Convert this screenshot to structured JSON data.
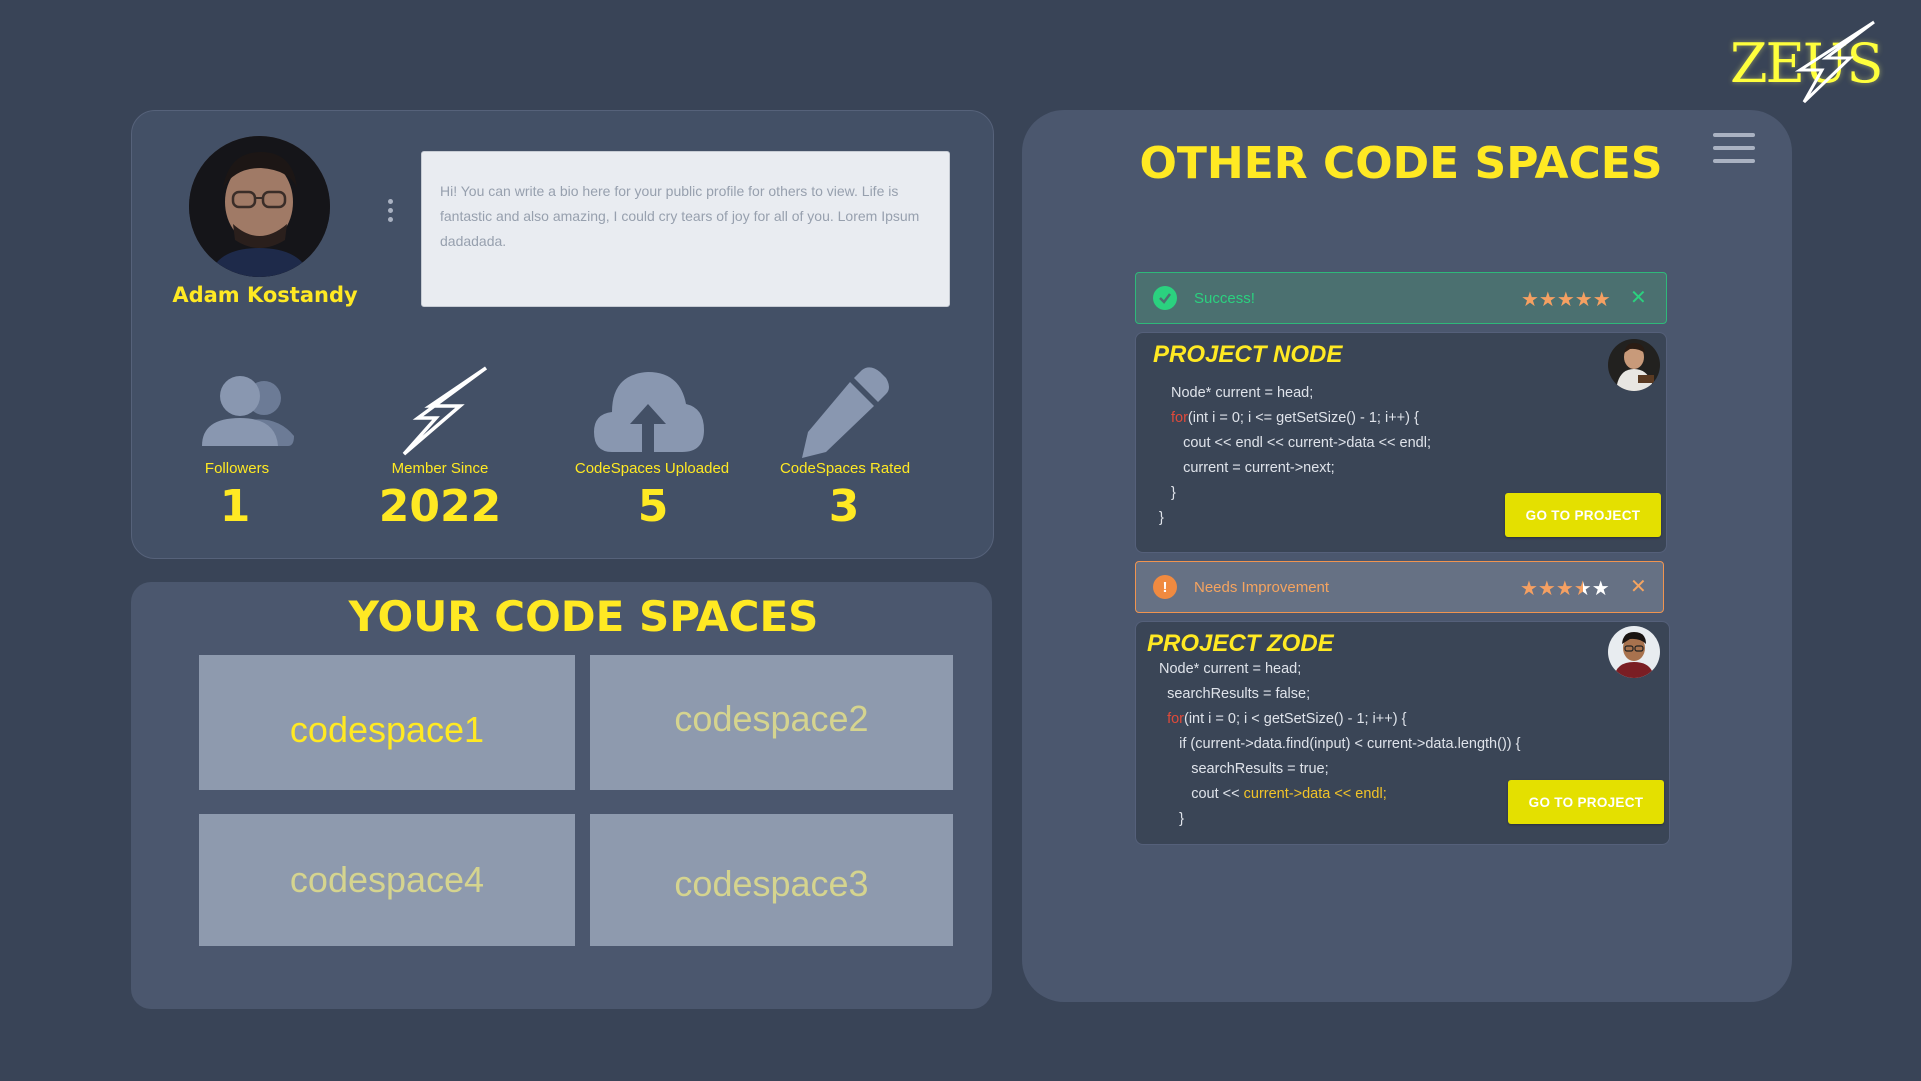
{
  "brand": {
    "logo_text": "ZEUS"
  },
  "profile": {
    "name": "Adam Kostandy",
    "bio": "Hi! You can write a bio here for your public profile for others to view. Life is fantastic and also amazing, I could cry tears of joy for all of you. Lorem Ipsum dadadada.",
    "stats": [
      {
        "label": "Followers",
        "value": "1",
        "icon": "users-icon"
      },
      {
        "label": "Member Since",
        "value": "2022",
        "icon": "lightning-icon"
      },
      {
        "label": "CodeSpaces Uploaded",
        "value": "5",
        "icon": "cloud-upload-icon"
      },
      {
        "label": "CodeSpaces Rated",
        "value": "3",
        "icon": "pencil-icon"
      }
    ]
  },
  "your_spaces": {
    "title": "YOUR CODE SPACES",
    "tiles": [
      "codespace1",
      "codespace2",
      "codespace4",
      "codespace3"
    ]
  },
  "other_spaces": {
    "title": "OTHER CODE SPACES",
    "alerts": [
      {
        "text": "Success!",
        "rating": 5,
        "color": "#2bd17f"
      },
      {
        "text": "Needs Improvement",
        "rating": 3.5,
        "color": "#f5a460"
      }
    ],
    "projects": [
      {
        "title": "PROJECT NODE",
        "button": "GO TO PROJECT",
        "code": [
          "Node* current = head;",
          "for(int i = 0; i <= getSetSize() - 1; i++) {",
          "cout << endl << current->data << endl;",
          "current = current->next;",
          "}",
          "}"
        ]
      },
      {
        "title": "PROJECT ZODE",
        "button": "GO TO PROJECT",
        "code": [
          "Node* current = head;",
          "searchResults = false;",
          "for(int i = 0; i < getSetSize() - 1; i++) {",
          "if (current->data.find(input) < current->data.length()) {",
          "searchResults = true;",
          "cout << current->data << endl;",
          "}"
        ]
      }
    ]
  },
  "colors": {
    "accent": "#ffe923",
    "background": "#394457",
    "card": "#435066"
  }
}
